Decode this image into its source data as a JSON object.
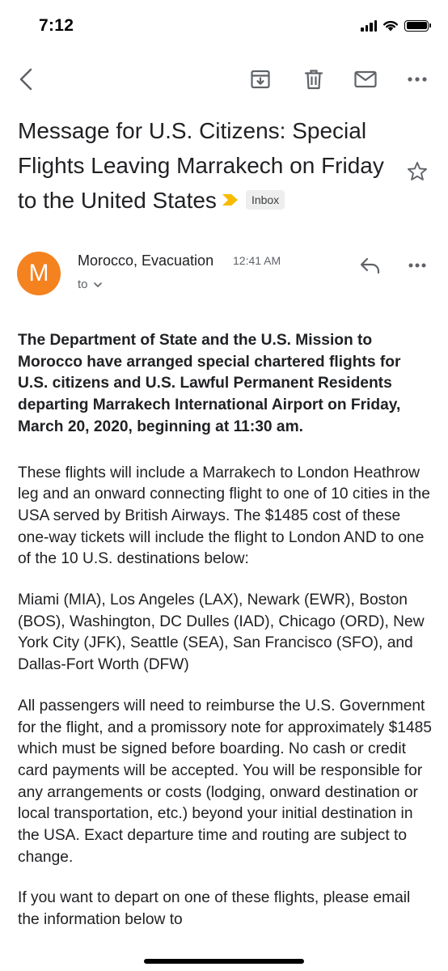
{
  "status_bar": {
    "time": "7:12"
  },
  "toolbar": {
    "back_icon": "chevron-left-icon",
    "archive_icon": "archive-icon",
    "delete_icon": "trash-icon",
    "mark_unread_icon": "mail-icon",
    "more_icon": "more-horizontal-icon"
  },
  "message": {
    "subject": "Message for U.S. Citizens: Special Flights Leaving Marrakech on Friday to the United States",
    "label": "Inbox",
    "importance_color": "#f9bb00",
    "sender": {
      "avatar_letter": "M",
      "avatar_color": "#f4821f",
      "name": "Morocco, Evacuation",
      "time": "12:41 AM",
      "recipients_label": "to"
    },
    "body": {
      "lead": "The Department of State and the U.S. Mission to Morocco have arranged special chartered flights for U.S. citizens and U.S. Lawful Permanent Residents departing Marrakech International Airport on Friday, March 20, 2020, beginning at 11:30 am.",
      "p1": "These flights will include a Marrakech to London Heathrow leg and an onward connecting flight to one of 10 cities in the USA served by British Airways.  The $1485 cost of these one-way tickets will include the flight to London AND to one of the 10 U.S. destinations below:",
      "p2": "Miami (MIA), Los Angeles (LAX), Newark (EWR), Boston (BOS), Washington, DC Dulles (IAD), Chicago (ORD), New York City (JFK), Seattle (SEA), San Francisco (SFO), and Dallas-Fort Worth (DFW)",
      "p3": "All passengers will need to reimburse the U.S. Government for the flight, and a promissory note for approximately $1485 which must be signed before boarding.  No cash or credit card payments will be accepted.  You will be responsible for any arrangements or costs (lodging, onward destination or local transportation, etc.) beyond your initial destination in the USA.   Exact departure time and routing are subject to change.",
      "p4": "If you want to depart on one of these flights, please email the information below to"
    }
  },
  "colors": {
    "text": "#202124",
    "secondary_text": "#5f6368",
    "icon": "#5f6368"
  }
}
